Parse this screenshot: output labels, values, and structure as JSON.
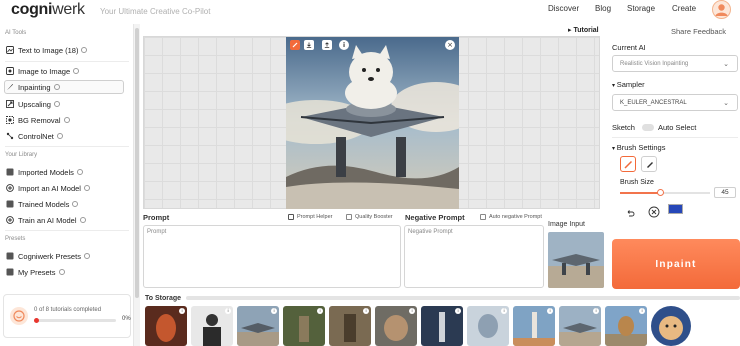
{
  "header": {
    "logo_bold": "cogni",
    "logo_thin": "werk",
    "tagline": "Your Ultimate Creative Co-Pilot",
    "nav": [
      "Discover",
      "Blog",
      "Storage",
      "Create"
    ]
  },
  "sidebar": {
    "sections": {
      "ai_tools": "AI Tools",
      "library": "Your Library",
      "presets": "Presets"
    },
    "ai_tools": [
      {
        "label": "Text to Image (18)",
        "icon": "text-image-icon"
      },
      {
        "label": "Image to Image",
        "icon": "image-image-icon"
      },
      {
        "label": "Inpainting",
        "icon": "brush-icon"
      },
      {
        "label": "Upscaling",
        "icon": "upscale-icon"
      },
      {
        "label": "BG Removal",
        "icon": "bg-removal-icon"
      },
      {
        "label": "ControlNet",
        "icon": "controlnet-icon"
      }
    ],
    "library": [
      {
        "label": "Imported Models",
        "icon": "layers-icon"
      },
      {
        "label": "Import an AI Model",
        "icon": "plus-icon"
      },
      {
        "label": "Trained Models",
        "icon": "layers-icon"
      },
      {
        "label": "Train an AI Model",
        "icon": "plus-icon"
      }
    ],
    "presets": [
      {
        "label": "Cogniwerk Presets",
        "icon": "preset-icon"
      },
      {
        "label": "My Presets",
        "icon": "preset-icon"
      }
    ],
    "tutorials": {
      "text": "0 of 8 tutorials completed",
      "percent": "0%",
      "progress": 0
    }
  },
  "canvas": {
    "tutorial_label": "Tutorial",
    "tools": [
      "brush-tool-icon",
      "download-icon",
      "upload-icon",
      "info-icon",
      "close-icon"
    ]
  },
  "prompts": {
    "prompt_label": "Prompt",
    "prompt_helper": "Prompt Helper",
    "quality_booster": "Quality Booster",
    "prompt_placeholder": "Prompt",
    "negative_label": "Negative Prompt",
    "auto_negative": "Auto negative Prompt",
    "negative_placeholder": "Negative Prompt",
    "image_input_label": "Image Input"
  },
  "right_panel": {
    "share_feedback": "Share Feedback",
    "current_ai_label": "Current AI",
    "current_ai_value": "Realistic Vision Inpainting",
    "sampler_label": "Sampler",
    "sampler_value": "K_EULER_ANCESTRAL",
    "sketch_label": "Sketch",
    "auto_select_label": "Auto Select",
    "brush_settings_label": "Brush Settings",
    "brush_size_label": "Brush Size",
    "brush_size_value": "45",
    "brush_size_fraction": 0.45,
    "inpaint_button": "Inpaint",
    "accent_color": "#f36a3a"
  },
  "storage": {
    "label": "To Storage",
    "thumbnails": 12
  }
}
